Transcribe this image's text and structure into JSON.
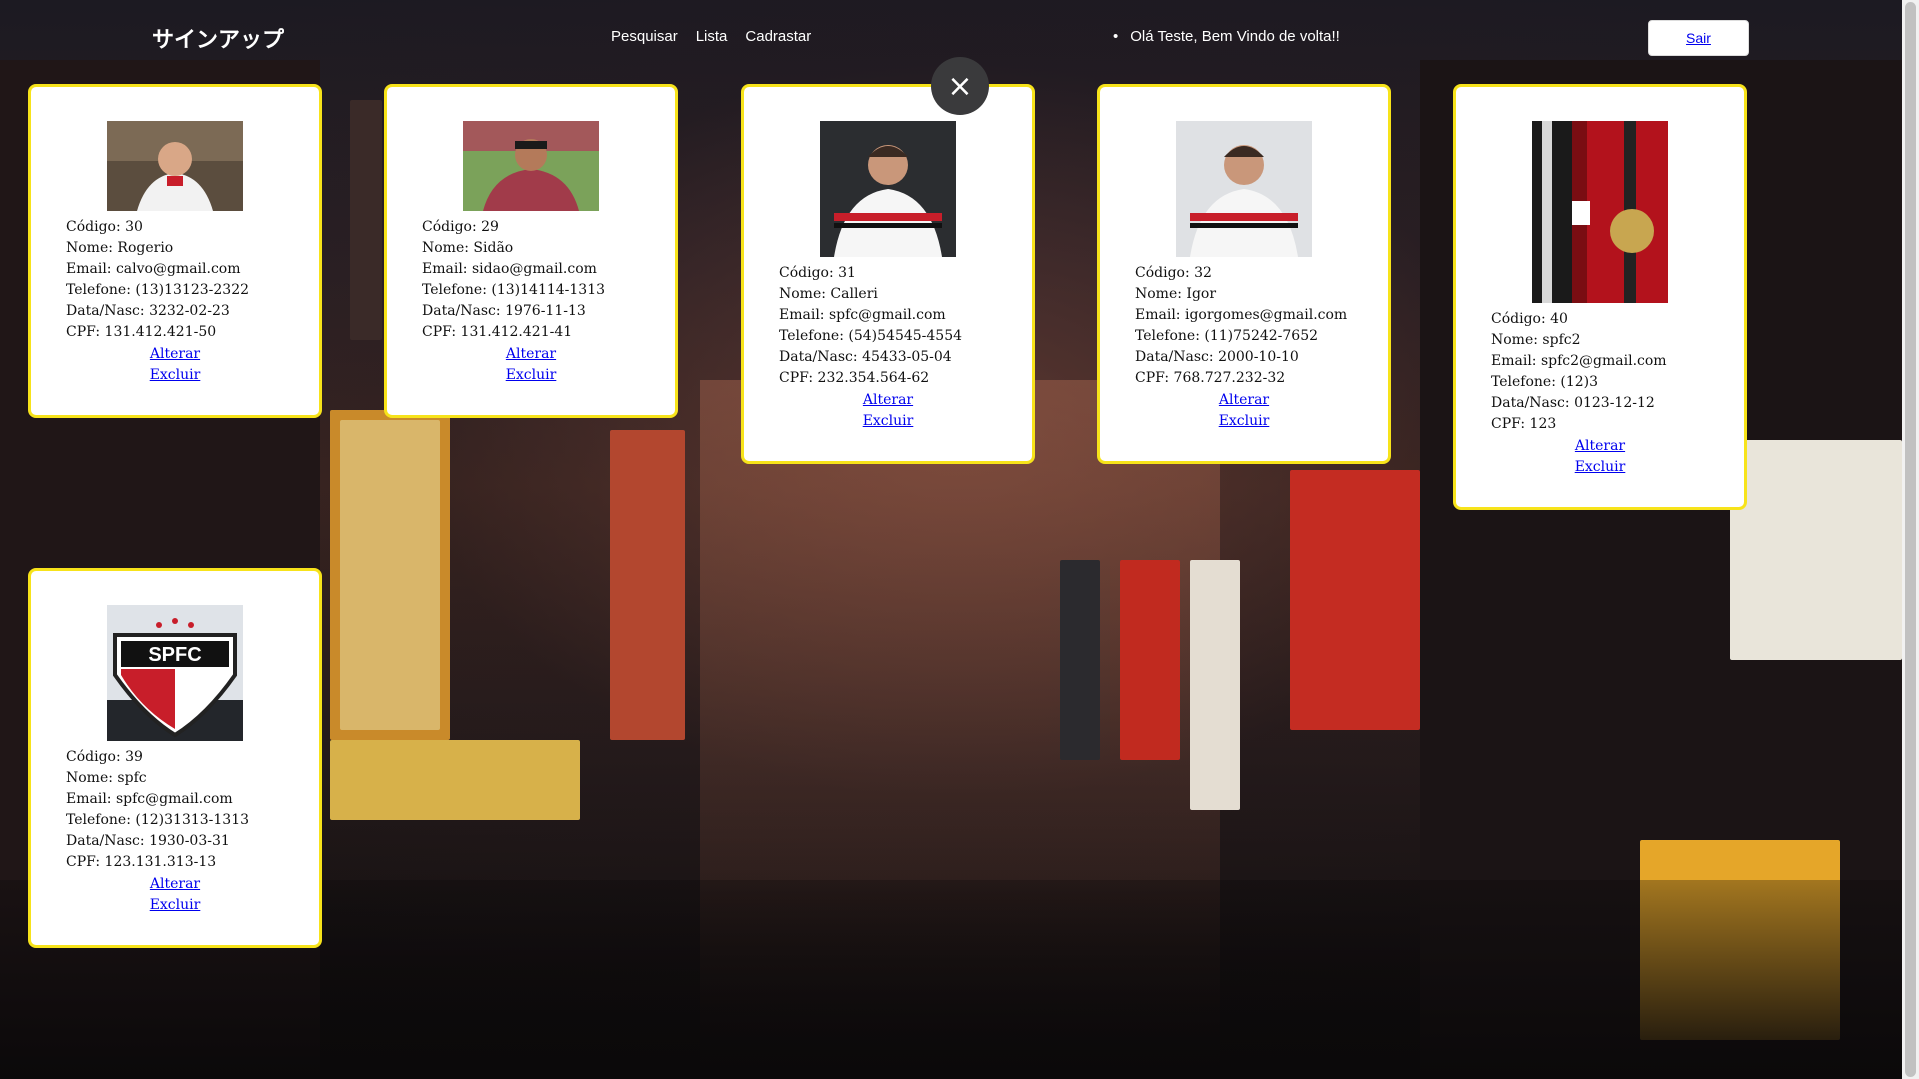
{
  "nav": {
    "brand": "サインアップ",
    "links": [
      "Pesquisar",
      "Lista",
      "Cadrastar"
    ],
    "welcome": "Olá Teste, Bem Vindo de volta!!",
    "logout": "Sair"
  },
  "close_label": "×",
  "labels": {
    "code": "Código:",
    "name": "Nome:",
    "email": "Email:",
    "phone": "Telefone:",
    "birth": "Data/Nasc:",
    "cpf": "CPF:",
    "edit": "Alterar",
    "delete": "Excluir"
  },
  "cards": [
    {
      "codigo": "30",
      "nome": "Rogerio",
      "email": "calvo@gmail.com",
      "telefone": "(13)13123-2322",
      "nasc": "3232-02-23",
      "cpf": "131.412.421-50"
    },
    {
      "codigo": "29",
      "nome": "Sidão",
      "email": "sidao@gmail.com",
      "telefone": "(13)14114-1313",
      "nasc": "1976-11-13",
      "cpf": "131.412.421-41"
    },
    {
      "codigo": "31",
      "nome": "Calleri",
      "email": "spfc@gmail.com",
      "telefone": "(54)54545-4554",
      "nasc": "45433-05-04",
      "cpf": "232.354.564-62"
    },
    {
      "codigo": "32",
      "nome": "Igor",
      "email": "igorgomes@gmail.com",
      "telefone": "(11)75242-7652",
      "nasc": "2000-10-10",
      "cpf": "768.727.232-32"
    },
    {
      "codigo": "40",
      "nome": "spfc2",
      "email": "spfc2@gmail.com",
      "telefone": "(12)3",
      "nasc": "0123-12-12",
      "cpf": "123"
    },
    {
      "codigo": "39",
      "nome": "spfc",
      "email": "spfc@gmail.com",
      "telefone": "(12)31313-1313",
      "nasc": "1930-03-31",
      "cpf": "123.131.313-13"
    }
  ],
  "photo_badge_text": "SPFC"
}
